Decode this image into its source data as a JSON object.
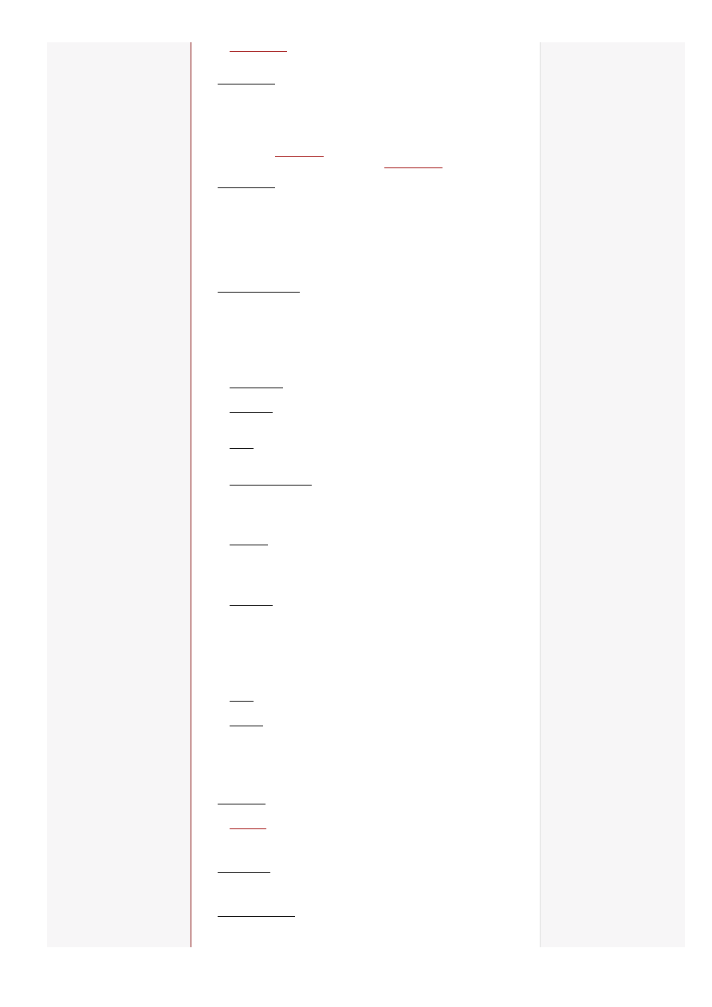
{
  "colors": {
    "sidebar_bg": "#f7f6f7",
    "content_bg": "#ffffff",
    "main_divider": "#8b1a1a",
    "right_divider": "#dedede",
    "link_underline": "#111111",
    "visited_link_underline": "#a31515"
  },
  "page": {
    "note": ""
  }
}
